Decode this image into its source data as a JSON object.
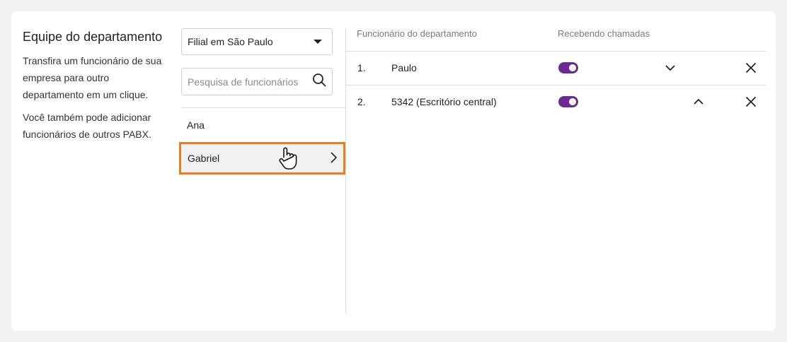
{
  "info": {
    "title": "Equipe do departamento",
    "paragraph1": "Transfira um funcionário de sua empresa para outro departamento em um clique.",
    "paragraph2": "Você também pode adicionar funcionários de outros PABX."
  },
  "branch_select": {
    "value": "Filial em São Paulo"
  },
  "search": {
    "placeholder": "Pesquisa de funcionários",
    "value": ""
  },
  "employees": [
    {
      "name": "Ana"
    },
    {
      "name": "Gabriel",
      "selected": true
    }
  ],
  "table": {
    "headers": {
      "employee": "Funcionário do departamento",
      "receiving": "Recebendo chamadas"
    },
    "rows": [
      {
        "index": "1.",
        "name": "Paulo",
        "receiving": true,
        "expander": "chevron-down-icon"
      },
      {
        "index": "2.",
        "name": "5342 (Escritório central)",
        "receiving": true,
        "expander": "chevron-up-icon"
      }
    ]
  },
  "colors": {
    "accent": "#6b2a92",
    "highlight": "#f07a1c"
  }
}
